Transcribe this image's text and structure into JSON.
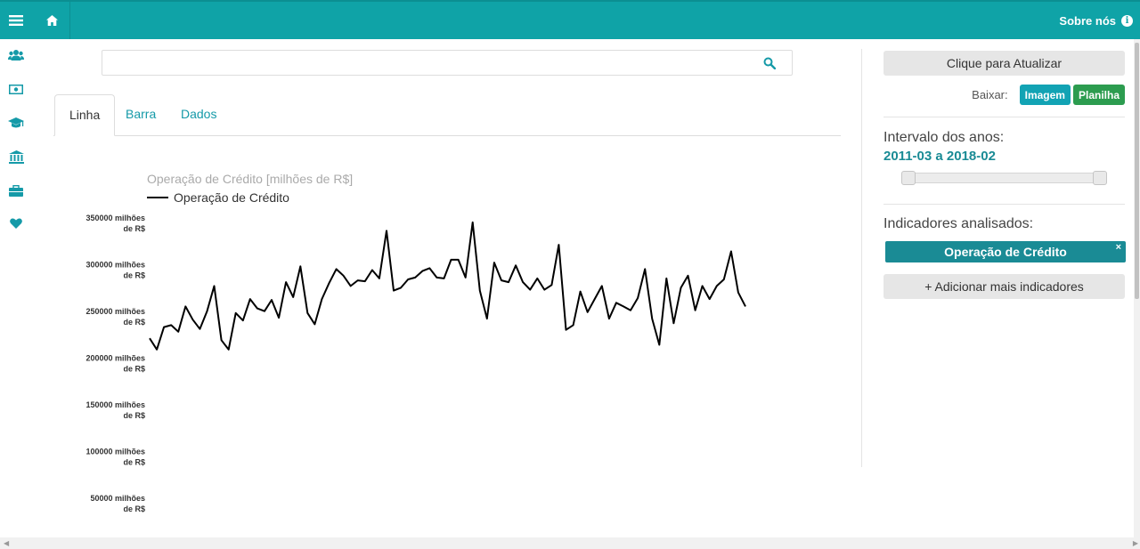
{
  "header": {
    "about_label": "Sobre nós",
    "icons": [
      "menu-icon",
      "home-icon",
      "info-icon"
    ],
    "accent_color": "#0fa3a7"
  },
  "sidebar": {
    "icons": [
      "users-icon",
      "money-icon",
      "graduation-cap-icon",
      "bank-icon",
      "briefcase-icon",
      "heart-icon"
    ]
  },
  "search": {
    "value": ""
  },
  "tabs": [
    {
      "label": "Linha",
      "active": true
    },
    {
      "label": "Barra",
      "active": false
    },
    {
      "label": "Dados",
      "active": false
    }
  ],
  "right_panel": {
    "refresh_label": "Clique para Atualizar",
    "download_label": "Baixar:",
    "image_label": "Imagem",
    "sheet_label": "Planilha",
    "range_label": "Intervalo dos anos:",
    "range_value": "2011-03 a 2018-02",
    "indicators_label": "Indicadores analisados:",
    "indicator_chip": "Operação de Crédito",
    "chip_close": "×",
    "add_label": "+ Adicionar mais indicadores"
  },
  "chart_data": {
    "type": "line",
    "title": "Operação de Crédito [milhões de R$]",
    "series": [
      {
        "name": "Operação de Crédito",
        "color": "#000000",
        "values": [
          227000,
          215000,
          239000,
          241000,
          234000,
          261000,
          247000,
          237000,
          256000,
          283000,
          225000,
          215000,
          254000,
          246000,
          269000,
          259000,
          256000,
          268000,
          249000,
          287000,
          271000,
          304000,
          254000,
          242000,
          269000,
          286000,
          301000,
          294000,
          283000,
          289000,
          288000,
          300000,
          291000,
          342000,
          278000,
          281000,
          290000,
          292000,
          299000,
          302000,
          292000,
          291000,
          311000,
          311000,
          292000,
          351000,
          278000,
          248000,
          308000,
          289000,
          287000,
          305000,
          287000,
          279000,
          291000,
          279000,
          284000,
          327000,
          236000,
          241000,
          277000,
          255000,
          269000,
          283000,
          248000,
          265000,
          261000,
          257000,
          270000,
          301000,
          248000,
          220000,
          291000,
          243000,
          281000,
          294000,
          257000,
          283000,
          269000,
          283000,
          290000,
          320000,
          276000,
          261000
        ]
      }
    ],
    "y_ticks": [
      350000,
      300000,
      250000,
      200000,
      150000,
      100000,
      50000
    ],
    "y_tick_labels": [
      "350000 milhões de R$",
      "300000 milhões de R$",
      "250000 milhões de R$",
      "200000 milhões de R$",
      "150000 milhões de R$",
      "100000 milhões de R$",
      "50000 milhões de R$"
    ],
    "ylim": [
      50000,
      350000
    ],
    "grid": false,
    "legend": "top-left"
  }
}
